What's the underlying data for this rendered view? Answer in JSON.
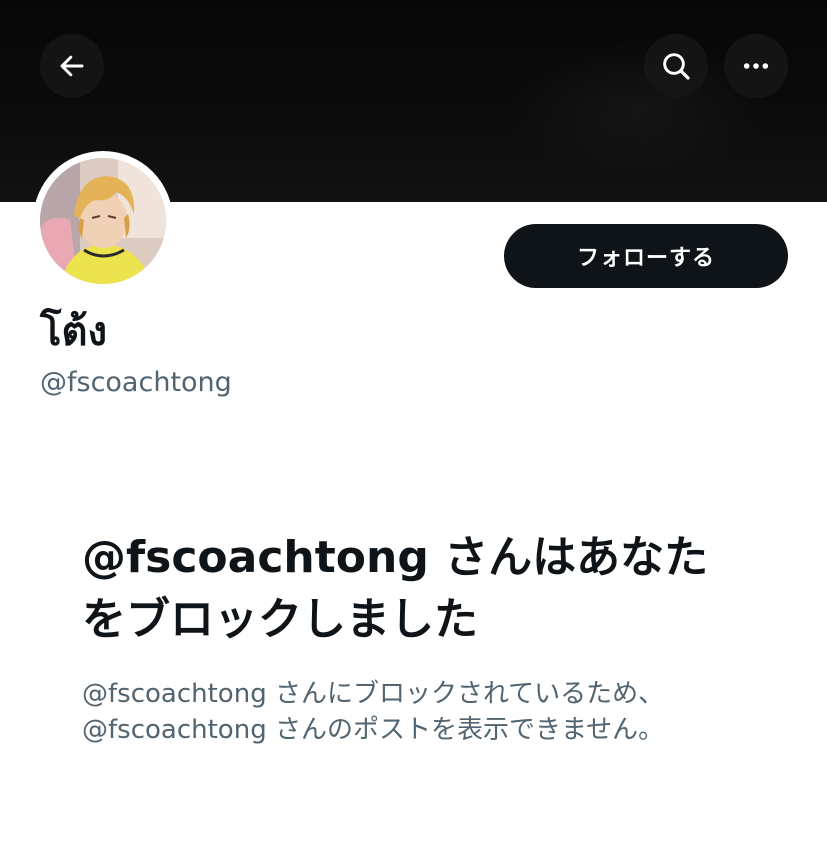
{
  "header": {
    "back_icon": "arrow-left-icon",
    "search_icon": "search-icon",
    "more_icon": "more-horizontal-icon"
  },
  "profile": {
    "display_name": "โต้ง",
    "handle": "@fscoachtong",
    "follow_label": "フォローする"
  },
  "blocked": {
    "title": "@fscoachtong さんはあなたをブロックしました",
    "description_line1": "@fscoachtong さんにブロックされているため、",
    "description_line2": "@fscoachtong さんのポストを表示できません。"
  },
  "colors": {
    "banner": "#0a0a0a",
    "primary_text": "#0f1419",
    "secondary_text": "#536471",
    "button_bg": "#0f1419",
    "button_text": "#ffffff"
  }
}
